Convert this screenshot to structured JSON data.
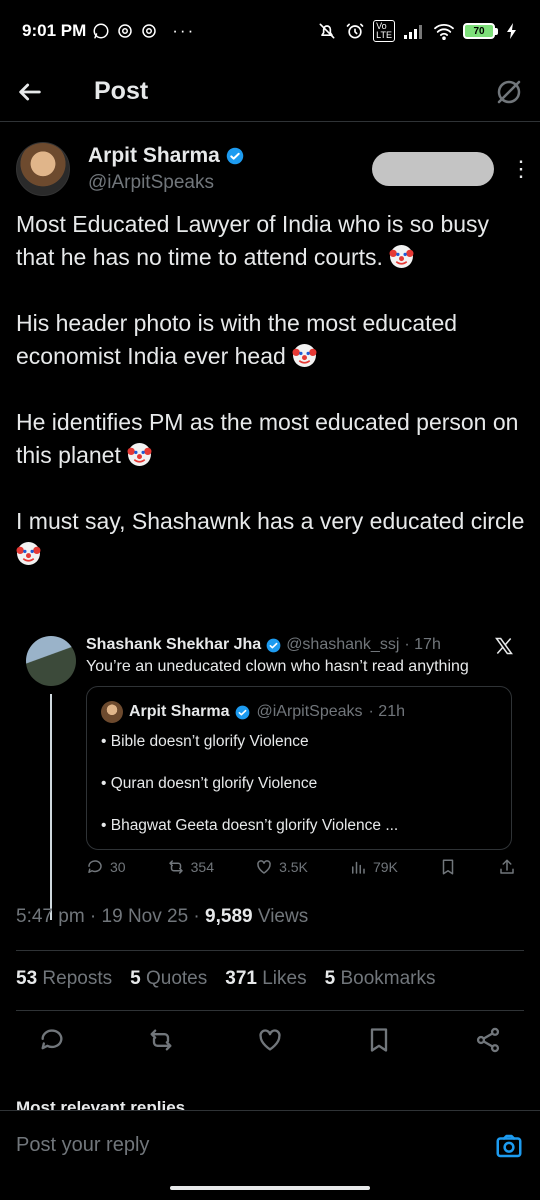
{
  "status_bar": {
    "time": "9:01 PM",
    "battery": "70",
    "icons": [
      "whatsapp-icon",
      "threads-icon",
      "threads-icon",
      "more-dots-icon",
      "mute-icon",
      "alarm-icon",
      "volte-icon",
      "signal-icon",
      "wifi-icon",
      "battery-icon",
      "charging-icon"
    ]
  },
  "header": {
    "title": "Post"
  },
  "post": {
    "author_name": "Arpit Sharma",
    "author_handle": "@iArpitSpeaks",
    "paragraphs": [
      "Most Educated Lawyer of India who is so busy that he has no time to attend courts.",
      "His header photo is with the most educated economist India ever head",
      "He identifies PM as the most educated person on this planet",
      "I must say, Shashawnk has a very educated circle"
    ],
    "timestamp": "5:47 pm · 19 Nov 25 · ",
    "views_count": "9,589",
    "views_label": " Views"
  },
  "embed": {
    "author_name": "Shashank Shekhar Jha",
    "author_handle": "@shashank_ssj",
    "age": "· 17h",
    "text": "You’re an uneducated clown who hasn’t read anything",
    "quoted": {
      "author_name": "Arpit Sharma",
      "author_handle": "@iArpitSpeaks",
      "age": "· 21h",
      "lines": [
        "• Bible doesn’t glorify Violence",
        "• Quran doesn’t glorify Violence",
        "• Bhagwat Geeta doesn’t glorify Violence ..."
      ]
    },
    "actions": {
      "replies": "30",
      "reposts": "354",
      "likes": "3.5K",
      "views": "79K"
    }
  },
  "stats": {
    "reposts_count": "53",
    "reposts_label": "Reposts",
    "quotes_count": "5",
    "quotes_label": "Quotes",
    "likes_count": "371",
    "likes_label": "Likes",
    "bookmarks_count": "5",
    "bookmarks_label": "Bookmarks"
  },
  "replies_header": "Most relevant replies",
  "reply_bar": {
    "placeholder": "Post your reply"
  },
  "colors": {
    "background": "#000000",
    "text": "#e7e9ea",
    "muted": "#71767b",
    "accent": "#1d9bf0",
    "verified": "#1d9bf0",
    "divider": "#2f3336"
  }
}
